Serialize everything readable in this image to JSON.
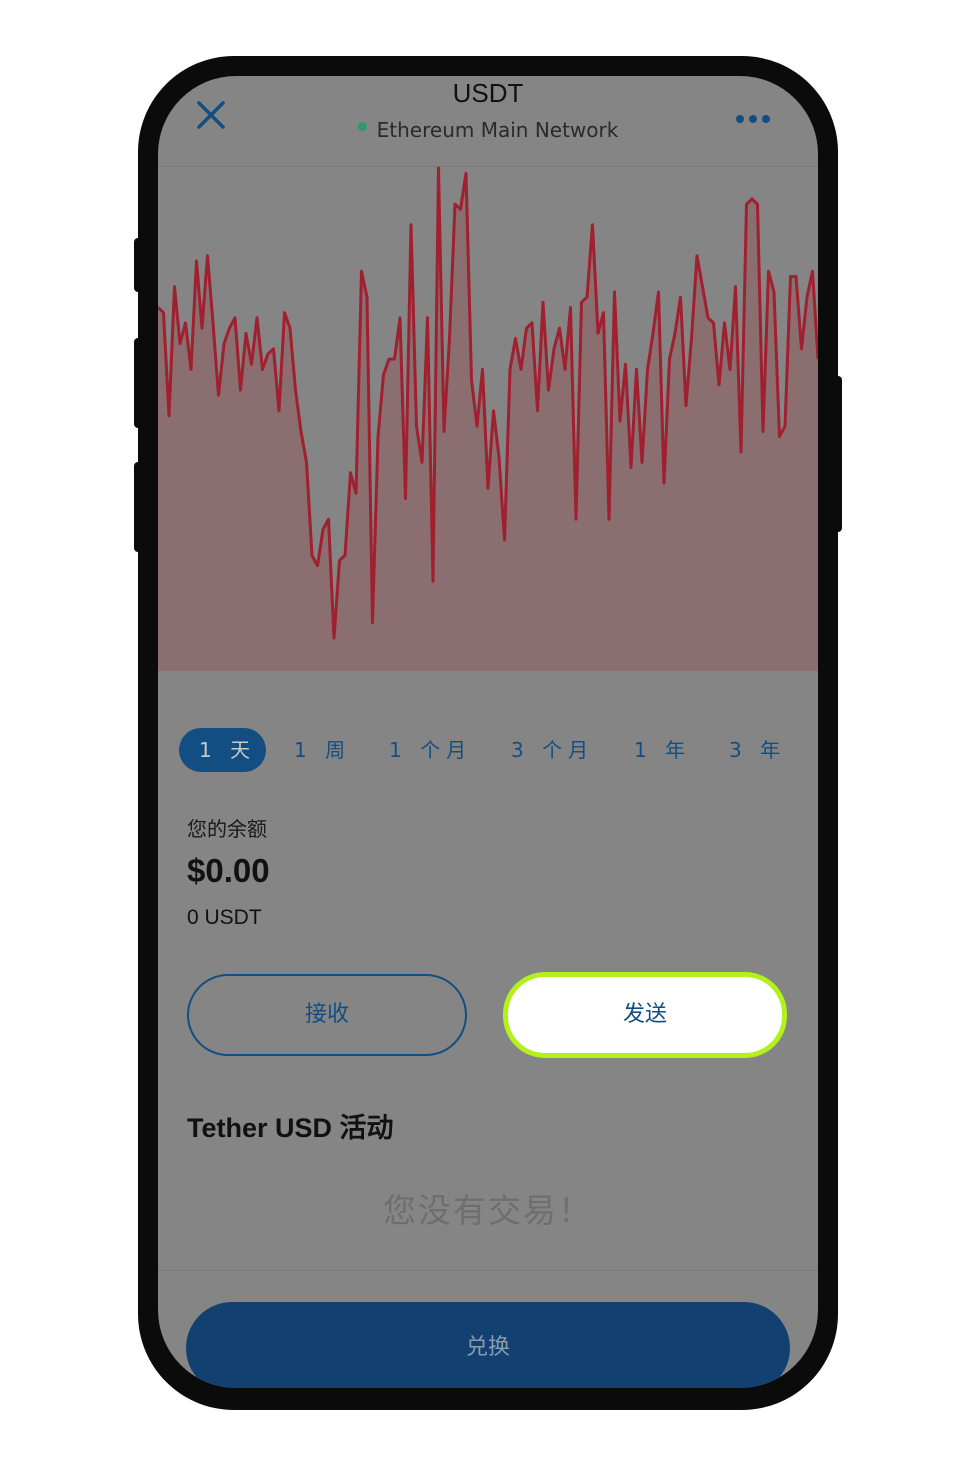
{
  "header": {
    "title": "USDT",
    "network": "Ethereum Main Network"
  },
  "chart_data": {
    "type": "area",
    "values": [
      64,
      63,
      43,
      68,
      57,
      61,
      52,
      73,
      60,
      74,
      61,
      47,
      57,
      60,
      62,
      48,
      59,
      53,
      62,
      52,
      55,
      56,
      44,
      63,
      60,
      48,
      40,
      34,
      16,
      14,
      21,
      23,
      0,
      15,
      16,
      32,
      28,
      71,
      66,
      3,
      39,
      51,
      54,
      54,
      62,
      27,
      80,
      41,
      34,
      62,
      11,
      91,
      40,
      58,
      84,
      83,
      90,
      50,
      41,
      52,
      29,
      44,
      35,
      19,
      52,
      58,
      52,
      60,
      61,
      44,
      65,
      48,
      56,
      60,
      52,
      64,
      23,
      65,
      66,
      80,
      59,
      63,
      23,
      67,
      42,
      53,
      33,
      52,
      34,
      52,
      59,
      67,
      30,
      54,
      59,
      66,
      45,
      58,
      74,
      68,
      62,
      61,
      49,
      61,
      52,
      68,
      36,
      84,
      85,
      84,
      40,
      71,
      67,
      39,
      41,
      70,
      70,
      56,
      66,
      71,
      54
    ],
    "line_color": "#a02030",
    "fill_color": "#8a6e70"
  },
  "ranges": [
    "1 天",
    "1 周",
    "1 个月",
    "3 个月",
    "1 年",
    "3 年"
  ],
  "balance": {
    "label": "您的余额",
    "value": "$0.00",
    "token": "0 USDT"
  },
  "actions": {
    "receive": "接收",
    "send": "发送"
  },
  "activity": {
    "title": "Tether USD 活动",
    "empty": "您没有交易！"
  },
  "swap_label": "兑换",
  "colors": {
    "accent": "#124e82",
    "highlight": "#b4f01c",
    "overlay": "#858585"
  }
}
